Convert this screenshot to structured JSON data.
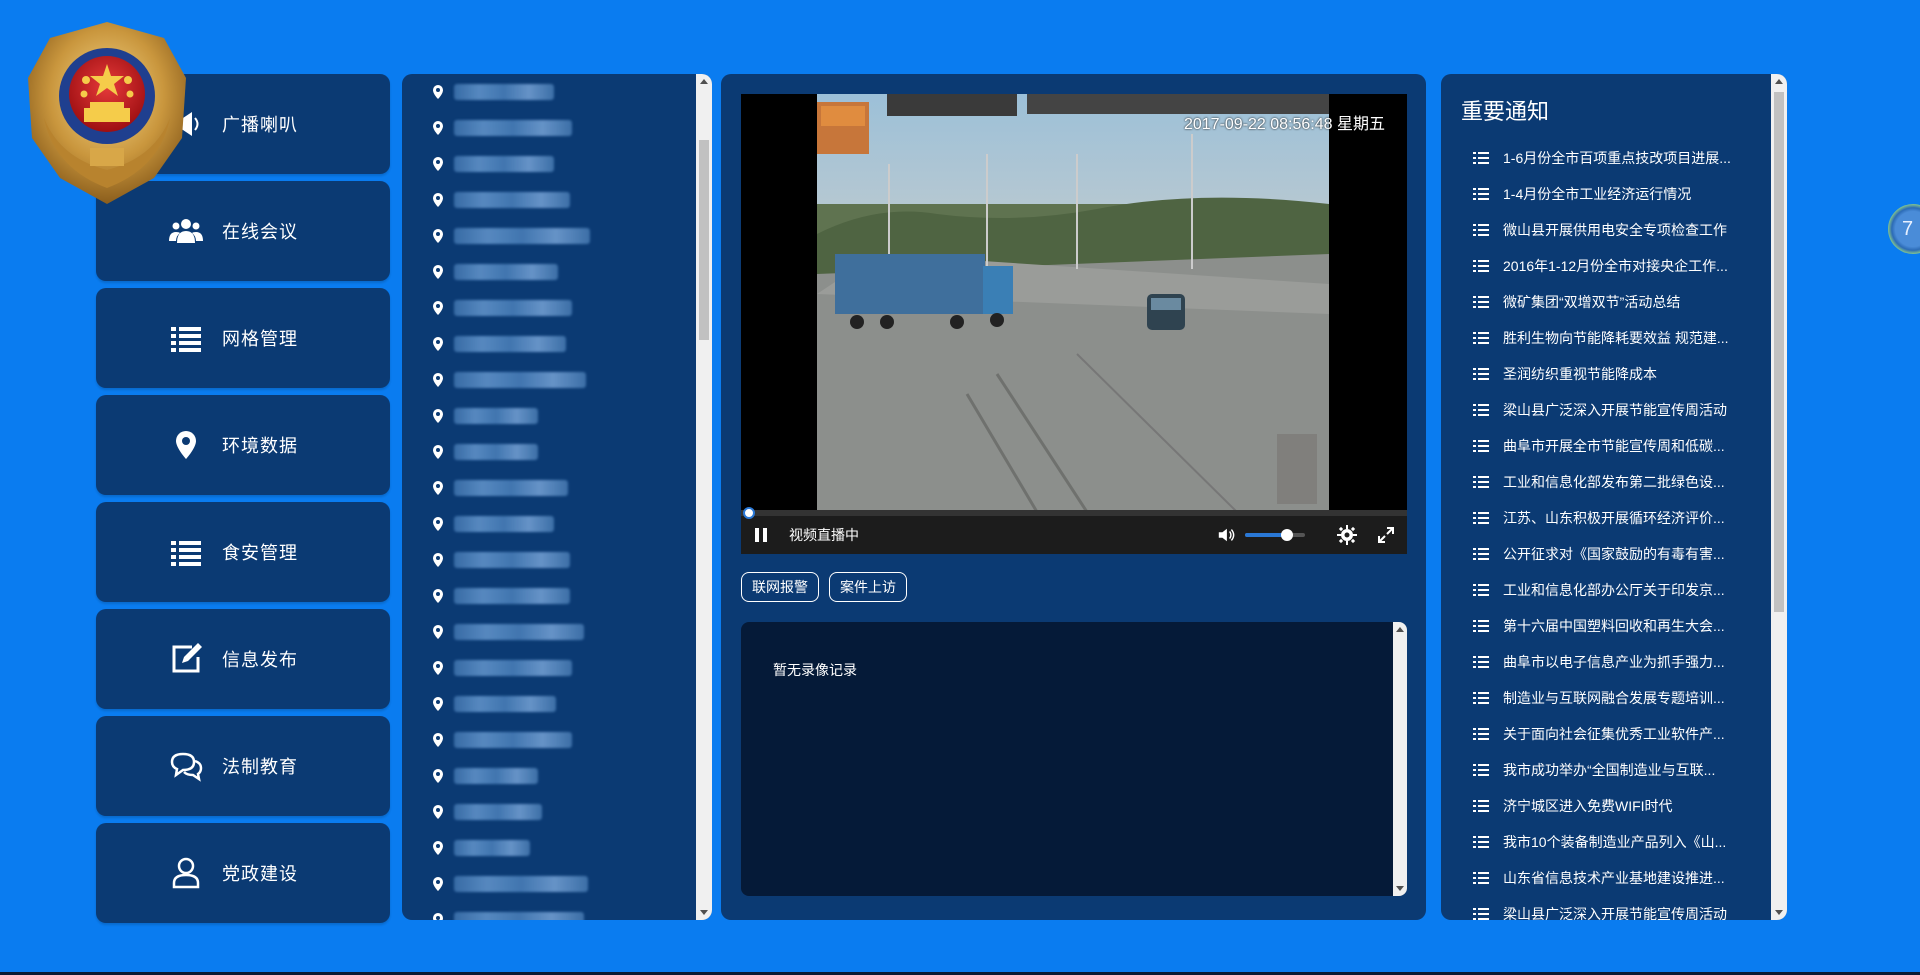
{
  "menu": [
    {
      "label": "广播喇叭",
      "icon": "megaphone-icon"
    },
    {
      "label": "在线会议",
      "icon": "group-icon"
    },
    {
      "label": "网格管理",
      "icon": "list-icon"
    },
    {
      "label": "环境数据",
      "icon": "map-pin-icon"
    },
    {
      "label": "食安管理",
      "icon": "list-icon"
    },
    {
      "label": "信息发布",
      "icon": "edit-icon"
    },
    {
      "label": "法制教育",
      "icon": "chat-icon"
    },
    {
      "label": "党政建设",
      "icon": "user-icon"
    }
  ],
  "video": {
    "timestamp": "2017-09-22 08:56:48 星期五",
    "status": "视频直播中",
    "volume_level": 0.7
  },
  "actions": {
    "alarm_label": "联网报警",
    "petition_label": "案件上访"
  },
  "records": {
    "empty_text": "暂无录像记录"
  },
  "notice": {
    "title": "重要通知",
    "items": [
      "1-6月份全市百项重点技改项目进展...",
      "1-4月份全市工业经济运行情况",
      "微山县开展供用电安全专项检查工作",
      "2016年1-12月份全市对接央企工作...",
      "微矿集团“双增双节”活动总结",
      "胜利生物向节能降耗要效益 规范建...",
      "圣润纺织重视节能降成本",
      "梁山县广泛深入开展节能宣传周活动",
      "曲阜市开展全市节能宣传周和低碳...",
      "工业和信息化部发布第二批绿色设...",
      "江苏、山东积极开展循环经济评价...",
      "公开征求对《国家鼓励的有毒有害...",
      "工业和信息化部办公厅关于印发京...",
      "第十六届中国塑料回收和再生大会...",
      "曲阜市以电子信息产业为抓手强力...",
      "制造业与互联网融合发展专题培训...",
      "关于面向社会征集优秀工业软件产...",
      "我市成功举办“全国制造业与互联...",
      "济宁城区进入免费WIFI时代",
      "我市10个装备制造业产品列入《山...",
      "山东省信息技术产业基地建设推进...",
      "梁山县广泛深入开展节能宣传周活动"
    ]
  },
  "float_widget": {
    "text": "7"
  },
  "colors": {
    "background": "#0a7cf0",
    "panel": "#0b3a73",
    "record_bg": "#051a38",
    "accent": "#2a78d6"
  }
}
